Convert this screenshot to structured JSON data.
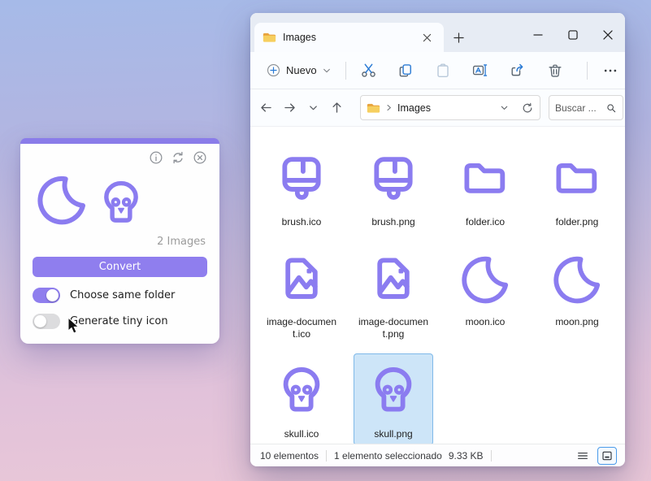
{
  "converter": {
    "window_icons": [
      "info-icon",
      "reload-icon",
      "close-circle-icon"
    ],
    "preview_icons": [
      "moon",
      "skull"
    ],
    "count_label": "2 Images",
    "convert_button": "Convert",
    "toggles": [
      {
        "label": "Choose same folder",
        "on": true
      },
      {
        "label": "Generate tiny icon",
        "on": false
      }
    ],
    "accent": "#8f7eee"
  },
  "explorer": {
    "tab_title": "Images",
    "toolbar": {
      "new_button": "Nuevo",
      "icons": [
        "cut-icon",
        "copy-icon",
        "paste-icon",
        "rename-icon",
        "share-icon",
        "delete-icon",
        "more-icon"
      ]
    },
    "navbar": {
      "address_path": "Images",
      "search_placeholder": "Buscar ..."
    },
    "files": [
      {
        "name": "brush.ico",
        "icon": "brush"
      },
      {
        "name": "brush.png",
        "icon": "brush"
      },
      {
        "name": "folder.ico",
        "icon": "folder"
      },
      {
        "name": "folder.png",
        "icon": "folder"
      },
      {
        "name": "image-document.ico",
        "icon": "image"
      },
      {
        "name": "image-document.png",
        "icon": "image"
      },
      {
        "name": "moon.ico",
        "icon": "moon"
      },
      {
        "name": "moon.png",
        "icon": "moon"
      },
      {
        "name": "skull.ico",
        "icon": "skull"
      },
      {
        "name": "skull.png",
        "icon": "skull",
        "selected": true
      }
    ],
    "statusbar": {
      "count": "10 elementos",
      "selected": "1 elemento seleccionado",
      "size": "9.33 KB"
    }
  },
  "colors": {
    "file_icon_purple": "#8b7cf0",
    "selection_bg": "#cde5f8",
    "selection_border": "#7fb9e9",
    "toolbar_blue": "#2b7bd4",
    "accent_strip": "#8a7ce9"
  }
}
